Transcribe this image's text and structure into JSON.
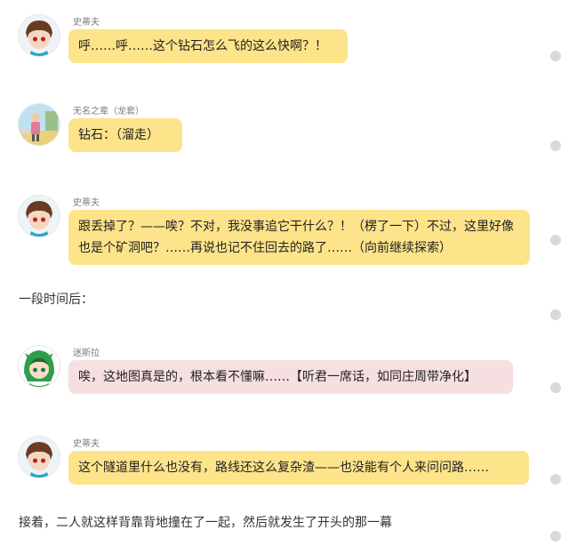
{
  "messages": [
    {
      "speaker": "史蒂夫",
      "text": "呼……呼……这个钻石怎么飞的这么快啊？！",
      "style": "yellow",
      "avatar": "steve-avatar"
    },
    {
      "speaker": "无名之辈（龙套）",
      "text": "钻石：（溜走）",
      "style": "yellow",
      "avatar": "extra-avatar"
    },
    {
      "speaker": "史蒂夫",
      "text": "跟丢掉了？——唉？不对，我没事追它干什么？！（楞了一下）不过，这里好像也是个矿洞吧？……再说也记不住回去的路了……（向前继续探索）",
      "style": "yellow",
      "avatar": "steve-avatar"
    },
    {
      "speaker": "迷斯拉",
      "text": "唉，这地图真是的，根本看不懂嘛……【听君一席话，如同庄周带净化】",
      "style": "pink",
      "avatar": "misla-avatar"
    },
    {
      "speaker": "史蒂夫",
      "text": "这个隧道里什么也没有，路线还这么复杂渣——也没能有个人来问问路……",
      "style": "yellow",
      "avatar": "steve-avatar"
    }
  ],
  "narrations": [
    "一段时间后：",
    "接着，二人就这样背靠背地撞在了一起，然后就发生了开头的那一幕"
  ],
  "colors": {
    "yellow_bubble": "#fde38a",
    "pink_bubble": "#f6dfe0",
    "name_text": "#7a7a7a",
    "dot": "#d9d9d9"
  }
}
